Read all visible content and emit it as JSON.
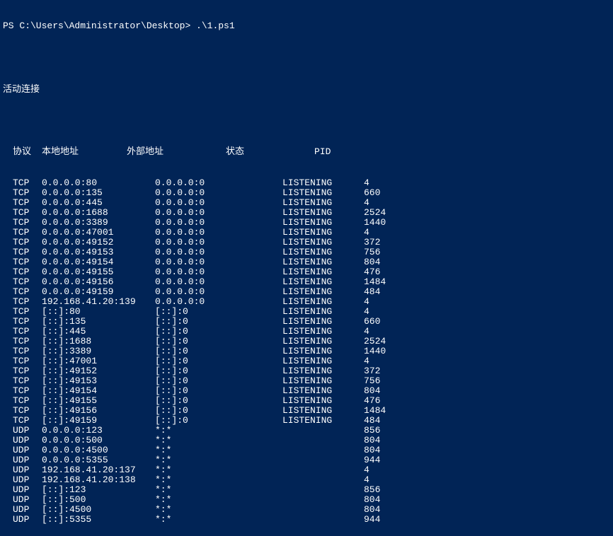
{
  "prompt": "PS C:\\Users\\Administrator\\Desktop> .\\1.ps1",
  "title": "活动连接",
  "headers": {
    "proto": "协议",
    "local": "本地地址",
    "foreign": "外部地址",
    "state": "状态",
    "pid": "PID"
  },
  "rows": [
    {
      "proto": "TCP",
      "local": "0.0.0.0:80",
      "foreign": "0.0.0.0:0",
      "state": "LISTENING",
      "pid": "4"
    },
    {
      "proto": "TCP",
      "local": "0.0.0.0:135",
      "foreign": "0.0.0.0:0",
      "state": "LISTENING",
      "pid": "660"
    },
    {
      "proto": "TCP",
      "local": "0.0.0.0:445",
      "foreign": "0.0.0.0:0",
      "state": "LISTENING",
      "pid": "4"
    },
    {
      "proto": "TCP",
      "local": "0.0.0.0:1688",
      "foreign": "0.0.0.0:0",
      "state": "LISTENING",
      "pid": "2524"
    },
    {
      "proto": "TCP",
      "local": "0.0.0.0:3389",
      "foreign": "0.0.0.0:0",
      "state": "LISTENING",
      "pid": "1440"
    },
    {
      "proto": "TCP",
      "local": "0.0.0.0:47001",
      "foreign": "0.0.0.0:0",
      "state": "LISTENING",
      "pid": "4"
    },
    {
      "proto": "TCP",
      "local": "0.0.0.0:49152",
      "foreign": "0.0.0.0:0",
      "state": "LISTENING",
      "pid": "372"
    },
    {
      "proto": "TCP",
      "local": "0.0.0.0:49153",
      "foreign": "0.0.0.0:0",
      "state": "LISTENING",
      "pid": "756"
    },
    {
      "proto": "TCP",
      "local": "0.0.0.0:49154",
      "foreign": "0.0.0.0:0",
      "state": "LISTENING",
      "pid": "804"
    },
    {
      "proto": "TCP",
      "local": "0.0.0.0:49155",
      "foreign": "0.0.0.0:0",
      "state": "LISTENING",
      "pid": "476"
    },
    {
      "proto": "TCP",
      "local": "0.0.0.0:49156",
      "foreign": "0.0.0.0:0",
      "state": "LISTENING",
      "pid": "1484"
    },
    {
      "proto": "TCP",
      "local": "0.0.0.0:49159",
      "foreign": "0.0.0.0:0",
      "state": "LISTENING",
      "pid": "484"
    },
    {
      "proto": "TCP",
      "local": "192.168.41.20:139",
      "foreign": "0.0.0.0:0",
      "state": "LISTENING",
      "pid": "4"
    },
    {
      "proto": "TCP",
      "local": "[::]:80",
      "foreign": "[::]:0",
      "state": "LISTENING",
      "pid": "4"
    },
    {
      "proto": "TCP",
      "local": "[::]:135",
      "foreign": "[::]:0",
      "state": "LISTENING",
      "pid": "660"
    },
    {
      "proto": "TCP",
      "local": "[::]:445",
      "foreign": "[::]:0",
      "state": "LISTENING",
      "pid": "4"
    },
    {
      "proto": "TCP",
      "local": "[::]:1688",
      "foreign": "[::]:0",
      "state": "LISTENING",
      "pid": "2524"
    },
    {
      "proto": "TCP",
      "local": "[::]:3389",
      "foreign": "[::]:0",
      "state": "LISTENING",
      "pid": "1440"
    },
    {
      "proto": "TCP",
      "local": "[::]:47001",
      "foreign": "[::]:0",
      "state": "LISTENING",
      "pid": "4"
    },
    {
      "proto": "TCP",
      "local": "[::]:49152",
      "foreign": "[::]:0",
      "state": "LISTENING",
      "pid": "372"
    },
    {
      "proto": "TCP",
      "local": "[::]:49153",
      "foreign": "[::]:0",
      "state": "LISTENING",
      "pid": "756"
    },
    {
      "proto": "TCP",
      "local": "[::]:49154",
      "foreign": "[::]:0",
      "state": "LISTENING",
      "pid": "804"
    },
    {
      "proto": "TCP",
      "local": "[::]:49155",
      "foreign": "[::]:0",
      "state": "LISTENING",
      "pid": "476"
    },
    {
      "proto": "TCP",
      "local": "[::]:49156",
      "foreign": "[::]:0",
      "state": "LISTENING",
      "pid": "1484"
    },
    {
      "proto": "TCP",
      "local": "[::]:49159",
      "foreign": "[::]:0",
      "state": "LISTENING",
      "pid": "484"
    },
    {
      "proto": "UDP",
      "local": "0.0.0.0:123",
      "foreign": "*:*",
      "state": "",
      "pid": "856"
    },
    {
      "proto": "UDP",
      "local": "0.0.0.0:500",
      "foreign": "*:*",
      "state": "",
      "pid": "804"
    },
    {
      "proto": "UDP",
      "local": "0.0.0.0:4500",
      "foreign": "*:*",
      "state": "",
      "pid": "804"
    },
    {
      "proto": "UDP",
      "local": "0.0.0.0:5355",
      "foreign": "*:*",
      "state": "",
      "pid": "944"
    },
    {
      "proto": "UDP",
      "local": "192.168.41.20:137",
      "foreign": "*:*",
      "state": "",
      "pid": "4"
    },
    {
      "proto": "UDP",
      "local": "192.168.41.20:138",
      "foreign": "*:*",
      "state": "",
      "pid": "4"
    },
    {
      "proto": "UDP",
      "local": "[::]:123",
      "foreign": "*:*",
      "state": "",
      "pid": "856"
    },
    {
      "proto": "UDP",
      "local": "[::]:500",
      "foreign": "*:*",
      "state": "",
      "pid": "804"
    },
    {
      "proto": "UDP",
      "local": "[::]:4500",
      "foreign": "*:*",
      "state": "",
      "pid": "804"
    },
    {
      "proto": "UDP",
      "local": "[::]:5355",
      "foreign": "*:*",
      "state": "",
      "pid": "944"
    }
  ]
}
